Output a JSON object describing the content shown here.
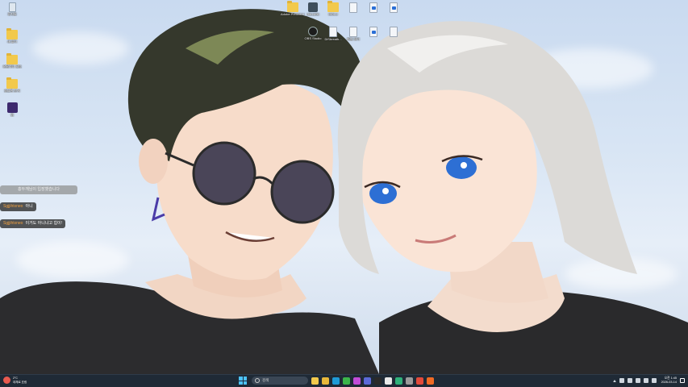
{
  "desktop": {
    "left_icons": [
      {
        "icon": "recycle-bin-icon",
        "label": "휴지통"
      },
      {
        "icon": "folder-icon",
        "label": "새 폴더"
      },
      {
        "icon": "folder-icon",
        "label": "유틸리티 모음"
      },
      {
        "icon": "folder-icon",
        "label": "중요한 문서"
      },
      {
        "icon": "app-icon",
        "label": "앱"
      }
    ],
    "top_icons": [
      {
        "icon": "folder-icon",
        "label": "Adobe Premiere P..."
      },
      {
        "icon": "app-icon",
        "label": "HitList96"
      },
      {
        "icon": "folder-icon",
        "label": "MOLU"
      },
      {
        "icon": "document-icon",
        "label": ""
      },
      {
        "icon": "document-icon",
        "label": ""
      },
      {
        "icon": "document-icon",
        "label": ""
      },
      {
        "icon": "obs-icon",
        "label": "OBS Studio"
      },
      {
        "icon": "document-icon",
        "label": "DiSbreath..."
      },
      {
        "icon": "document-icon",
        "label": "파일 정리"
      },
      {
        "icon": "document-icon",
        "label": ""
      },
      {
        "icon": "document-icon",
        "label": ""
      }
    ]
  },
  "chat": {
    "notice": "홍두깨님이 입장했습니다",
    "messages": [
      {
        "user": "Sgjjihtxneo",
        "text": "아니"
      },
      {
        "user": "Sgjjihtxneo",
        "text": "이거도 아니냐고 힘이!"
      }
    ]
  },
  "taskbar": {
    "weather_temp": "2°C",
    "weather_text": "대체로 흐림",
    "search_placeholder": "검색",
    "apps": [
      {
        "icon": "file-explorer-icon",
        "color": "#f2c94c"
      },
      {
        "icon": "folder-icon",
        "color": "#e8b83a"
      },
      {
        "icon": "edge-icon",
        "color": "#1f9ad6"
      },
      {
        "icon": "chrome-icon",
        "color": "#3bb54a"
      },
      {
        "icon": "app-icon",
        "color": "#c24bd8"
      },
      {
        "icon": "app-icon",
        "color": "#5b6ad8"
      },
      {
        "icon": "terminal-icon",
        "color": "#2a2a2a"
      },
      {
        "icon": "app-icon",
        "color": "#e9e9e9"
      },
      {
        "icon": "app-icon",
        "color": "#2fb17a"
      },
      {
        "icon": "app-icon",
        "color": "#9b9b9b"
      },
      {
        "icon": "app-icon",
        "color": "#e24a3b"
      },
      {
        "icon": "app-icon",
        "color": "#f06a24"
      }
    ],
    "clock_time": "오전 1:45",
    "clock_date": "2026-03-14"
  }
}
